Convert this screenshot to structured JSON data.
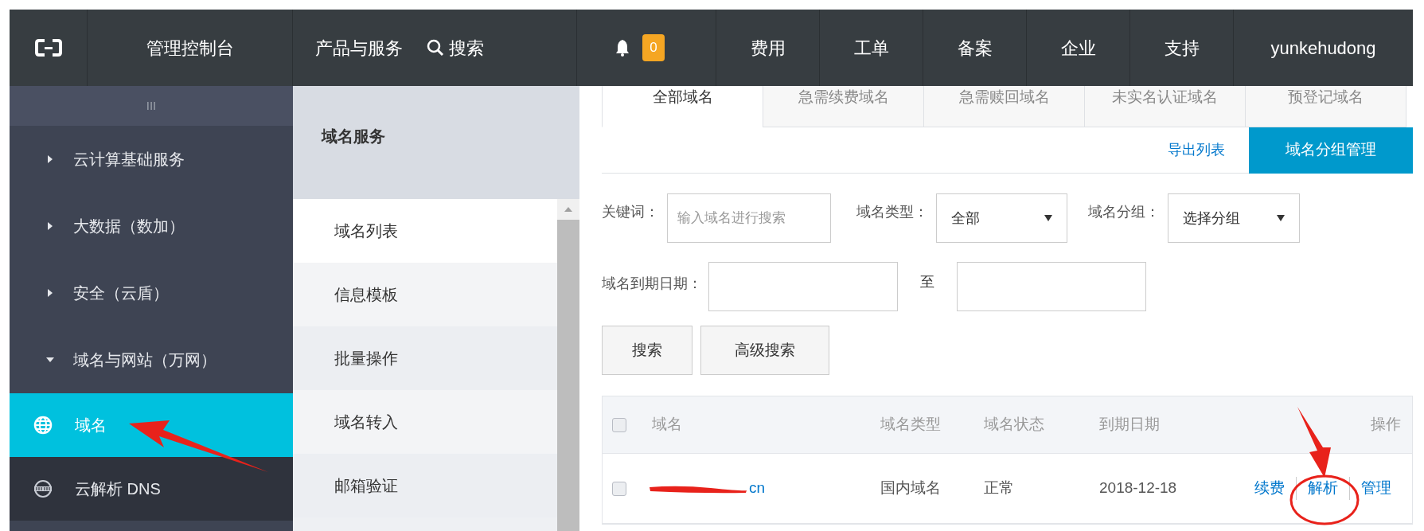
{
  "top_nav": {
    "title": "管理控制台",
    "items": [
      {
        "label": "产品与服务"
      },
      {
        "label": "搜索"
      }
    ],
    "notifications": "0",
    "links": [
      {
        "label": "费用"
      },
      {
        "label": "工单"
      },
      {
        "label": "备案"
      },
      {
        "label": "企业"
      },
      {
        "label": "支持"
      },
      {
        "label": "yunkehudong"
      }
    ]
  },
  "sidebar": {
    "handle": "III",
    "groups": [
      {
        "label": "云计算基础服务",
        "expanded": false
      },
      {
        "label": "大数据（数加）",
        "expanded": false
      },
      {
        "label": "安全（云盾）",
        "expanded": false
      },
      {
        "label": "域名与网站（万网）",
        "expanded": true,
        "children": [
          {
            "label": "域名",
            "selected": true
          },
          {
            "label": "云解析 DNS",
            "selected": false
          }
        ]
      }
    ]
  },
  "submenu": {
    "title": "域名服务",
    "items": [
      {
        "label": "域名列表",
        "selected": true
      },
      {
        "label": "信息模板",
        "selected": false
      },
      {
        "label": "批量操作",
        "selected": false
      },
      {
        "label": "域名转入",
        "selected": false
      },
      {
        "label": "邮箱验证",
        "selected": false
      }
    ]
  },
  "tabs": [
    {
      "label": "全部域名",
      "selected": true
    },
    {
      "label": "急需续费域名",
      "selected": false
    },
    {
      "label": "急需赎回域名",
      "selected": false
    },
    {
      "label": "未实名认证域名",
      "selected": false
    },
    {
      "label": "预登记域名",
      "selected": false
    }
  ],
  "toolbar": {
    "export_link": "导出列表",
    "group_button": "域名分组管理"
  },
  "filters": {
    "keyword_label": "关键词：",
    "keyword_placeholder": "输入域名进行搜索",
    "type_label": "域名类型：",
    "type_value": "全部",
    "group_label": "域名分组：",
    "group_value": "选择分组",
    "expiry_label": "域名到期日期：",
    "to_label": "至",
    "search_button": "搜索",
    "advanced_button": "高级搜索"
  },
  "table": {
    "select_all_checked": false,
    "columns": [
      "域名",
      "域名类型",
      "域名状态",
      "到期日期",
      "操作"
    ],
    "rows": [
      {
        "checked": false,
        "domain": "cn",
        "type": "国内域名",
        "status": "正常",
        "expiry": "2018-12-18",
        "actions": [
          "续费",
          "解析",
          "管理"
        ]
      }
    ]
  }
}
